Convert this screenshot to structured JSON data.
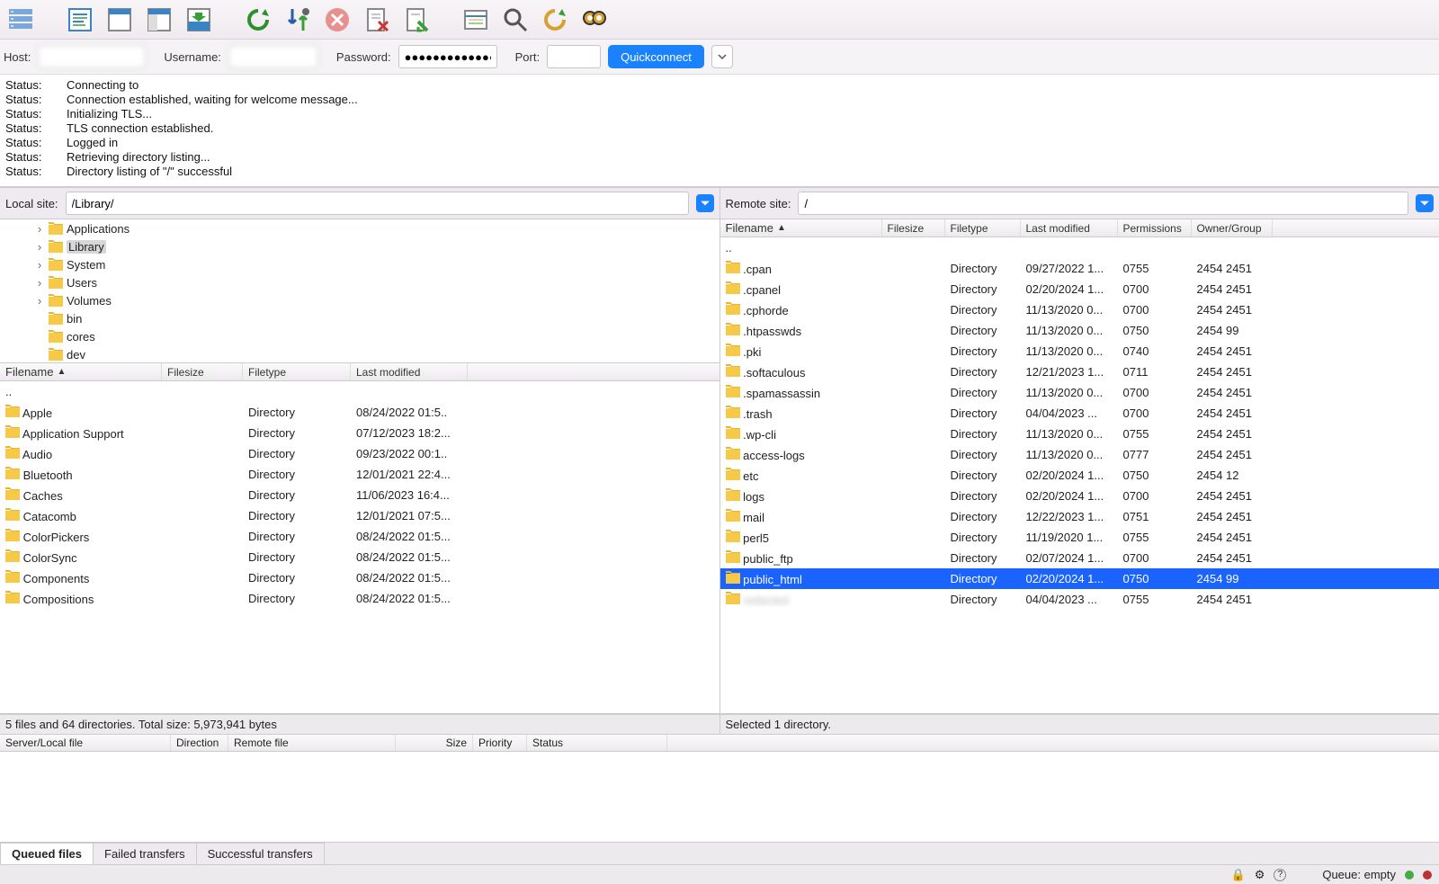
{
  "connect": {
    "host_label": "Host:",
    "username_label": "Username:",
    "password_label": "Password:",
    "port_label": "Port:",
    "host_value": "",
    "username_value": "",
    "password_value": "●●●●●●●●●●●●●",
    "port_value": "",
    "quickconnect": "Quickconnect"
  },
  "log": [
    {
      "label": "Status:",
      "msg": "Connecting to"
    },
    {
      "label": "Status:",
      "msg": "Connection established, waiting for welcome message..."
    },
    {
      "label": "Status:",
      "msg": "Initializing TLS..."
    },
    {
      "label": "Status:",
      "msg": "TLS connection established."
    },
    {
      "label": "Status:",
      "msg": "Logged in"
    },
    {
      "label": "Status:",
      "msg": "Retrieving directory listing..."
    },
    {
      "label": "Status:",
      "msg": "Directory listing of \"/\" successful"
    }
  ],
  "local": {
    "label": "Local site:",
    "path": "/Library/",
    "tree": [
      {
        "name": "Applications",
        "expand": true,
        "indent": 1
      },
      {
        "name": "Library",
        "expand": true,
        "indent": 1,
        "selected": true
      },
      {
        "name": "System",
        "expand": true,
        "indent": 1
      },
      {
        "name": "Users",
        "expand": true,
        "indent": 1
      },
      {
        "name": "Volumes",
        "expand": true,
        "indent": 1
      },
      {
        "name": "bin",
        "expand": false,
        "indent": 1
      },
      {
        "name": "cores",
        "expand": false,
        "indent": 1
      },
      {
        "name": "dev",
        "expand": false,
        "indent": 1
      }
    ],
    "cols": {
      "name": "Filename",
      "size": "Filesize",
      "type": "Filetype",
      "mod": "Last modified"
    },
    "rows": [
      {
        "name": "..",
        "type": "",
        "mod": "",
        "icon": "up"
      },
      {
        "name": "Apple",
        "type": "Directory",
        "mod": "08/24/2022 01:5.."
      },
      {
        "name": "Application Support",
        "type": "Directory",
        "mod": "07/12/2023 18:2..."
      },
      {
        "name": "Audio",
        "type": "Directory",
        "mod": "09/23/2022 00:1.."
      },
      {
        "name": "Bluetooth",
        "type": "Directory",
        "mod": "12/01/2021 22:4..."
      },
      {
        "name": "Caches",
        "type": "Directory",
        "mod": "11/06/2023 16:4..."
      },
      {
        "name": "Catacomb",
        "type": "Directory",
        "mod": "12/01/2021 07:5..."
      },
      {
        "name": "ColorPickers",
        "type": "Directory",
        "mod": "08/24/2022 01:5..."
      },
      {
        "name": "ColorSync",
        "type": "Directory",
        "mod": "08/24/2022 01:5..."
      },
      {
        "name": "Components",
        "type": "Directory",
        "mod": "08/24/2022 01:5..."
      },
      {
        "name": "Compositions",
        "type": "Directory",
        "mod": "08/24/2022 01:5..."
      }
    ],
    "status": "5 files and 64 directories. Total size: 5,973,941 bytes"
  },
  "remote": {
    "label": "Remote site:",
    "path": "/",
    "cols": {
      "name": "Filename",
      "size": "Filesize",
      "type": "Filetype",
      "mod": "Last modified",
      "perm": "Permissions",
      "own": "Owner/Group"
    },
    "rows": [
      {
        "name": "..",
        "type": "",
        "mod": "",
        "perm": "",
        "own": "",
        "icon": "up"
      },
      {
        "name": ".cpan",
        "type": "Directory",
        "mod": "09/27/2022 1...",
        "perm": "0755",
        "own": "2454 2451"
      },
      {
        "name": ".cpanel",
        "type": "Directory",
        "mod": "02/20/2024 1...",
        "perm": "0700",
        "own": "2454 2451"
      },
      {
        "name": ".cphorde",
        "type": "Directory",
        "mod": "11/13/2020 0...",
        "perm": "0700",
        "own": "2454 2451"
      },
      {
        "name": ".htpasswds",
        "type": "Directory",
        "mod": "11/13/2020 0...",
        "perm": "0750",
        "own": "2454 99"
      },
      {
        "name": ".pki",
        "type": "Directory",
        "mod": "11/13/2020 0...",
        "perm": "0740",
        "own": "2454 2451"
      },
      {
        "name": ".softaculous",
        "type": "Directory",
        "mod": "12/21/2023 1...",
        "perm": "0711",
        "own": "2454 2451"
      },
      {
        "name": ".spamassassin",
        "type": "Directory",
        "mod": "11/13/2020 0...",
        "perm": "0700",
        "own": "2454 2451"
      },
      {
        "name": ".trash",
        "type": "Directory",
        "mod": "04/04/2023 ...",
        "perm": "0700",
        "own": "2454 2451"
      },
      {
        "name": ".wp-cli",
        "type": "Directory",
        "mod": "11/13/2020 0...",
        "perm": "0755",
        "own": "2454 2451"
      },
      {
        "name": "access-logs",
        "type": "Directory",
        "mod": "11/13/2020 0...",
        "perm": "0777",
        "own": "2454 2451",
        "icon": "link"
      },
      {
        "name": "etc",
        "type": "Directory",
        "mod": "02/20/2024 1...",
        "perm": "0750",
        "own": "2454 12"
      },
      {
        "name": "logs",
        "type": "Directory",
        "mod": "02/20/2024 1...",
        "perm": "0700",
        "own": "2454 2451"
      },
      {
        "name": "mail",
        "type": "Directory",
        "mod": "12/22/2023 1...",
        "perm": "0751",
        "own": "2454 2451"
      },
      {
        "name": "perl5",
        "type": "Directory",
        "mod": "11/19/2020 1...",
        "perm": "0755",
        "own": "2454 2451"
      },
      {
        "name": "public_ftp",
        "type": "Directory",
        "mod": "02/07/2024 1...",
        "perm": "0700",
        "own": "2454 2451"
      },
      {
        "name": "public_html",
        "type": "Directory",
        "mod": "02/20/2024 1...",
        "perm": "0750",
        "own": "2454 99",
        "selected": true
      },
      {
        "name": "",
        "type": "Directory",
        "mod": "04/04/2023 ...",
        "perm": "0755",
        "own": "2454 2451",
        "blur": true
      }
    ],
    "status": "Selected 1 directory."
  },
  "queue": {
    "cols": {
      "server": "Server/Local file",
      "dir": "Direction",
      "remote": "Remote file",
      "size": "Size",
      "prio": "Priority",
      "status": "Status"
    },
    "tabs": {
      "queued": "Queued files",
      "failed": "Failed transfers",
      "success": "Successful transfers"
    }
  },
  "statusbar": {
    "queue": "Queue: empty"
  }
}
